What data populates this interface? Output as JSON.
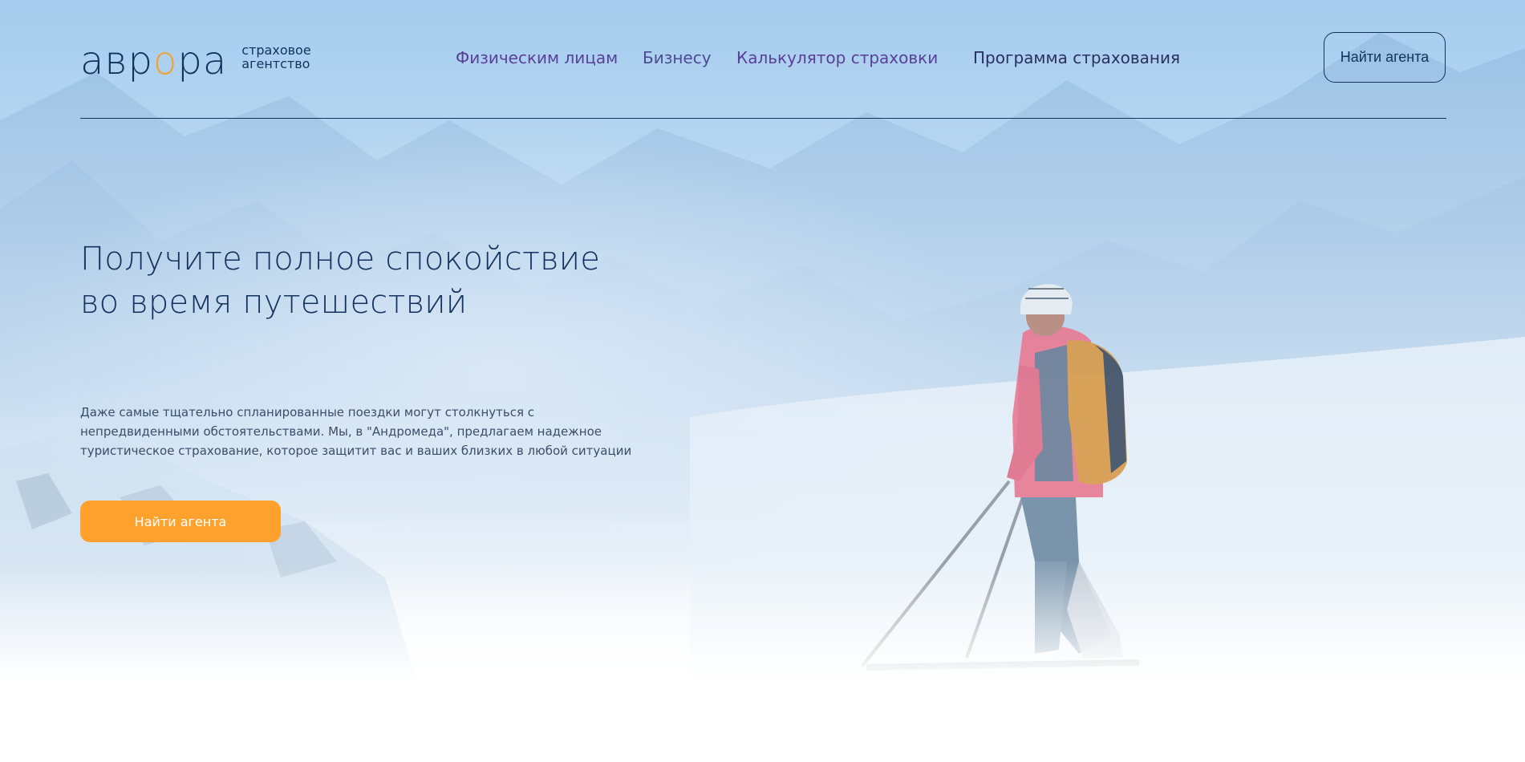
{
  "brand": {
    "name_start": "авр",
    "name_o": "о",
    "name_end": "ра",
    "tagline_line1": "страховое",
    "tagline_line2": "агентство",
    "accent_color": "#f5a02f",
    "primary_color": "#13325f"
  },
  "nav": {
    "items": [
      {
        "label": "Физическим лицам"
      },
      {
        "label": "Бизнесу"
      },
      {
        "label": "Калькулятор страховки"
      },
      {
        "label": "Программа страхования"
      }
    ]
  },
  "header": {
    "agent_button_label": "Найти агента"
  },
  "hero": {
    "headline": "Получите полное спокойствие во время путешествий",
    "lead": "Даже самые тщательно спланированные поездки могут столкнуться с непредвиденными обстоятельствами. Мы, в \"Андромеда\", предлагаем надежное туристическое страхование, которое защитит вас и ваших близких в любой ситуации",
    "cta_label": "Найти агента",
    "cta_color": "#fea22d",
    "background_image": "snowy-mountains-skier-photo"
  }
}
